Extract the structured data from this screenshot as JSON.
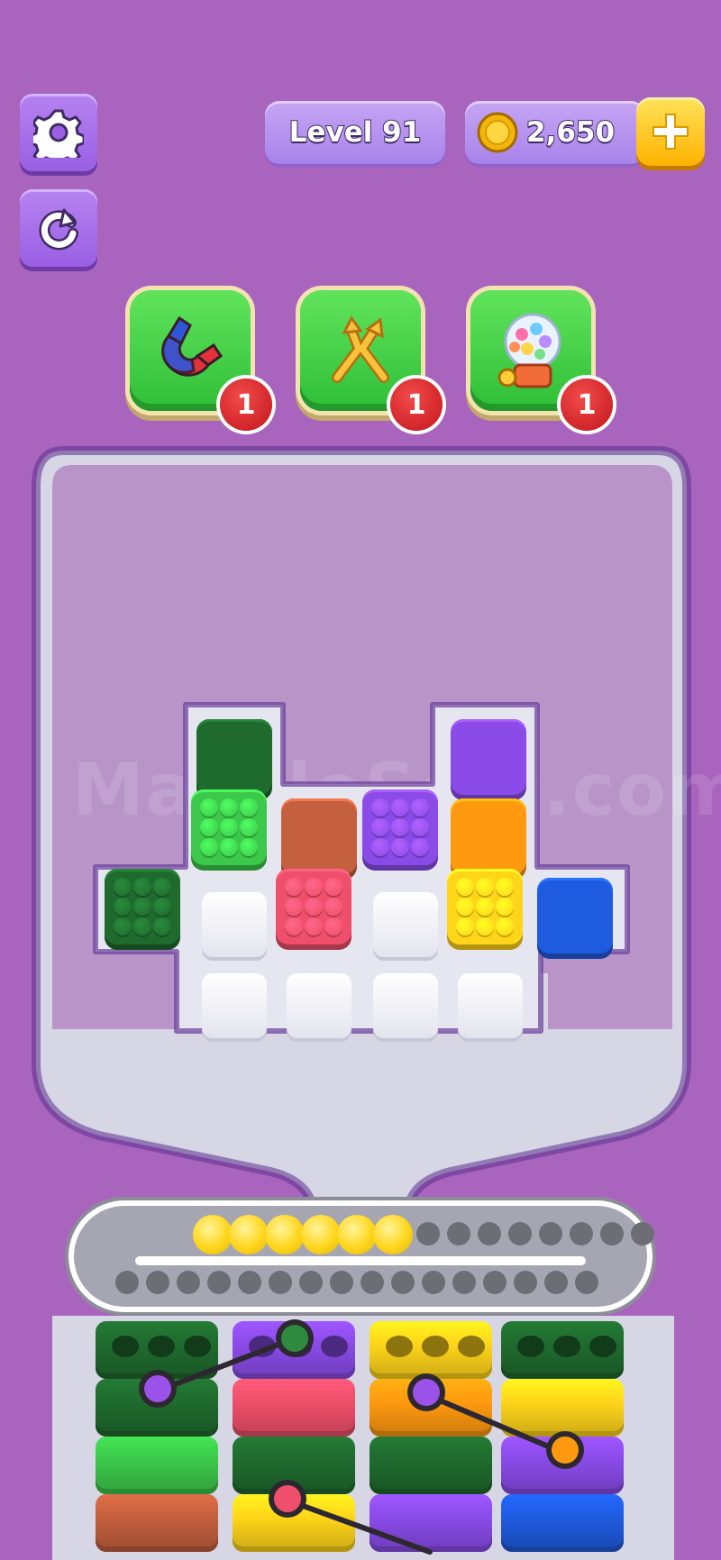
{
  "hud": {
    "level_label": "Level 91",
    "coins": "2,650",
    "settings_icon": "gear-icon",
    "restart_icon": "restart-icon",
    "add_coins_icon": "plus-icon",
    "coin_icon": "coin-icon"
  },
  "boosters": [
    {
      "name": "magnet",
      "icon": "magnet-icon",
      "count": "1"
    },
    {
      "name": "shuffle",
      "icon": "shuffle-arrows-icon",
      "count": "1"
    },
    {
      "name": "gumball",
      "icon": "gumball-machine-icon",
      "count": "1"
    }
  ],
  "watermark": "MarbleSort.com",
  "colors": {
    "background": "#a964bd",
    "green_dark": "#1f6b2e",
    "green": "#3cc84a",
    "brown": "#c4603e",
    "purple": "#8a4be8",
    "orange": "#ff9a10",
    "red_pink": "#ef4f6a",
    "yellow": "#ffd51a",
    "blue": "#1f5bdf"
  },
  "board": {
    "blocks": [
      {
        "color": "green_dark",
        "state": "closed"
      },
      {
        "color": "green",
        "state": "dotted"
      },
      {
        "color": "brown",
        "state": "closed"
      },
      {
        "color": "purple",
        "state": "dotted"
      },
      {
        "color": "purple",
        "state": "closed"
      },
      {
        "color": "orange",
        "state": "closed"
      },
      {
        "color": "green_dark",
        "state": "dotted"
      },
      {
        "color": "red_pink",
        "state": "dotted"
      },
      {
        "color": "yellow",
        "state": "dotted"
      },
      {
        "color": "blue",
        "state": "closed"
      }
    ]
  },
  "conveyor": {
    "balls": 6,
    "ball_color": "yellow"
  },
  "tube_columns": [
    [
      "green_dark",
      "green_dark",
      "green",
      "brown"
    ],
    [
      "purple",
      "red_pink",
      "green_dark",
      "yellow"
    ],
    [
      "yellow",
      "orange",
      "green_dark",
      "purple"
    ],
    [
      "green_dark",
      "yellow",
      "purple",
      "blue"
    ]
  ]
}
